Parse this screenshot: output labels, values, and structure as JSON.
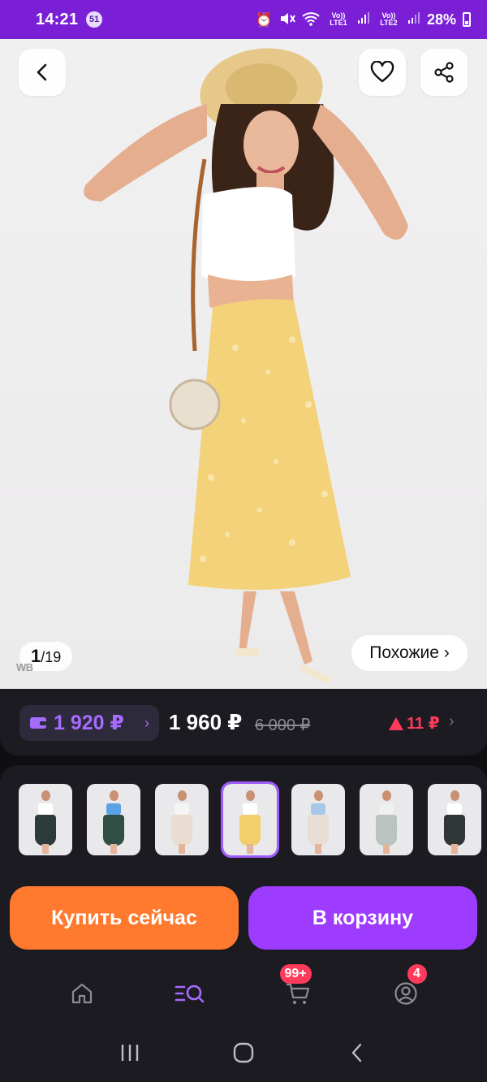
{
  "status_bar": {
    "time": "14:21",
    "notification_count": "51",
    "network_1": "Vo)) LTE1",
    "network_2": "Vo)) LTE2",
    "battery": "28%",
    "icons": [
      "alarm-icon",
      "mute-icon",
      "wifi-icon",
      "signal-icon",
      "signal-icon",
      "battery-icon"
    ]
  },
  "product": {
    "image_counter": {
      "current": "1",
      "total": "/19"
    },
    "watermark": "WB",
    "similar_label": "Похожие ›"
  },
  "price_bar": {
    "wallet_price": "1 920 ₽",
    "price": "1 960 ₽",
    "old_price": "6 000 ₽",
    "price_change": "11 ₽"
  },
  "thumbnails": [
    {
      "id": 1,
      "selected": false,
      "top_color": "#ffffff",
      "skirt_color": "#2d3a3a"
    },
    {
      "id": 2,
      "selected": false,
      "top_color": "#5aa3e6",
      "skirt_color": "#2f4f44"
    },
    {
      "id": 3,
      "selected": false,
      "top_color": "#f5f5f5",
      "skirt_color": "#e8ddd0"
    },
    {
      "id": 4,
      "selected": true,
      "top_color": "#ffffff",
      "skirt_color": "#f2cf6a"
    },
    {
      "id": 5,
      "selected": false,
      "top_color": "#a8c8e8",
      "skirt_color": "#e8ded6"
    },
    {
      "id": 6,
      "selected": false,
      "top_color": "#f0f0f0",
      "skirt_color": "#b8c4bd"
    },
    {
      "id": 7,
      "selected": false,
      "top_color": "#ffffff",
      "skirt_color": "#303636"
    }
  ],
  "actions": {
    "buy_now": "Купить сейчас",
    "add_to_cart": "В корзину"
  },
  "tab_bar": {
    "cart_badge": "99+",
    "profile_badge": "4"
  },
  "colors": {
    "brand_purple": "#7a1fd6",
    "buy_orange": "#ff7a2f",
    "cart_purple": "#9d3cff",
    "wallet_price": "#a66bff",
    "delta_red": "#ff3b5c"
  }
}
